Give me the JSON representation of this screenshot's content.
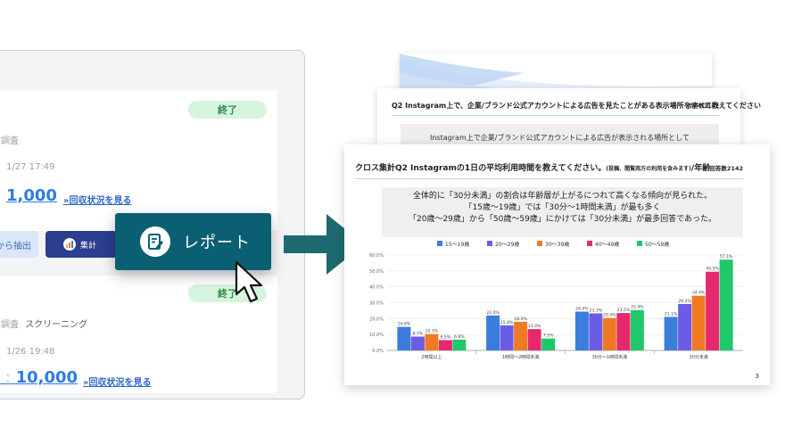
{
  "app": {
    "card1": {
      "status": "終了",
      "type_label": "調査",
      "date": "1/27 17:49",
      "count": "1,000",
      "progress_link": "»回収状況を見る"
    },
    "buttons": {
      "extract": "から抽出",
      "aggregate": "集計",
      "report": "レポート"
    },
    "card2": {
      "status": "終了",
      "type_label": "調査",
      "type_value": "スクリーニング",
      "date": "1/26 19:48",
      "count_prefix": "t : ",
      "count": "10,000",
      "progress_link": "»回収状況を見る"
    }
  },
  "report": {
    "mid_page": {
      "title": "Q2  Instagram上で、企業/ブランド公式アカウントによる広告を見たことがある表示場所をすべて教えてください",
      "count": "回答数2142",
      "summary": "Instagram上で企業/ブランド公式アカウントによる広告が表示される場所として"
    },
    "front_page": {
      "title": "クロス集計Q2  Instagramの1日の平均利用時間を教えてください。",
      "title_note": "(投稿、閲覧両方の利用を含みます)",
      "title_suffix": "/年齢",
      "count": "回答数2142",
      "summary": [
        "全体的に「30分未満」の割合は年齢層が上がるにつれて高くなる傾向が見られた。",
        "「15歳～19歳」では「30分～1時間未満」が最も多く",
        "「20歳～29歳」から「50歳～59歳」にかけては「30分未満」が最多回答であった。"
      ],
      "page_number": "3"
    }
  },
  "chart_data": {
    "type": "bar",
    "categories": [
      "2時間以上",
      "1時間～2時間未満",
      "30分～1時間未満",
      "30分未満"
    ],
    "series": [
      {
        "name": "15～19歳",
        "color": "#3b7ddd",
        "values": [
          14.8,
          22.0,
          24.4,
          21.1
        ]
      },
      {
        "name": "20～29歳",
        "color": "#6b5ce7",
        "values": [
          8.7,
          15.8,
          23.3,
          29.2
        ]
      },
      {
        "name": "30～39歳",
        "color": "#f07a22",
        "values": [
          10.3,
          18.0,
          20.4,
          34.4
        ]
      },
      {
        "name": "40～49歳",
        "color": "#e8286e",
        "values": [
          6.5,
          13.4,
          23.5,
          49.5
        ]
      },
      {
        "name": "50～59歳",
        "color": "#1fc96a",
        "values": [
          6.8,
          7.5,
          25.4,
          57.1
        ]
      }
    ],
    "value_labels": [
      [
        "14.8%",
        "22.0%",
        "24.4%",
        "21.1%"
      ],
      [
        "8.7%",
        "15.8%",
        "23.3%",
        "29.2%"
      ],
      [
        "10.3%",
        "18.0%",
        "20.4%",
        "34.4%"
      ],
      [
        "6.5%",
        "13.4%",
        "23.5%",
        "49.5%"
      ],
      [
        "6.8%",
        "7.5%",
        "25.4%",
        "57.1%"
      ]
    ],
    "yticks": [
      "0.0%",
      "10.0%",
      "20.0%",
      "30.0%",
      "40.0%",
      "50.0%",
      "60.0%"
    ],
    "ylim": [
      0,
      60
    ],
    "legend_position": "top",
    "grid": true
  },
  "colors": {
    "report_button": "#0b5f73",
    "arrow": "#1d6b70",
    "status_pill_bg": "#d6f5dc",
    "status_pill_text": "#2e8b4a",
    "link": "#2d66c8",
    "count": "#2d7de0",
    "aggregate_button": "#2b3e8f"
  },
  "icons": {
    "report": "report-document-icon",
    "aggregate": "bar-chart-icon",
    "cursor": "mouse-pointer-icon",
    "arrow": "arrow-right-icon"
  }
}
